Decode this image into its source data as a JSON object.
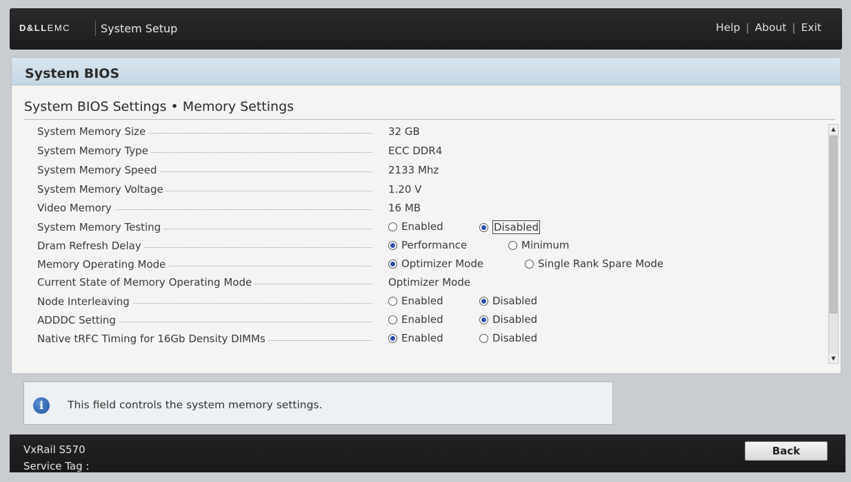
{
  "header": {
    "logo_bold": "D&LL",
    "logo_rest": "EMC",
    "title": "System Setup",
    "links": [
      "Help",
      "About",
      "Exit"
    ]
  },
  "panel": {
    "title": "System BIOS",
    "breadcrumb": "System BIOS Settings • Memory Settings"
  },
  "settings": [
    {
      "label": "System Memory Size",
      "value": "32 GB"
    },
    {
      "label": "System Memory Type",
      "value": "ECC DDR4"
    },
    {
      "label": "System Memory Speed",
      "value": "2133 Mhz"
    },
    {
      "label": "System Memory Voltage",
      "value": "1.20 V"
    },
    {
      "label": "Video Memory",
      "value": "16 MB"
    },
    {
      "label": "System Memory Testing",
      "options": [
        "Enabled",
        "Disabled"
      ],
      "selected": 1,
      "focused": 1
    },
    {
      "label": "Dram Refresh Delay",
      "options": [
        "Performance",
        "Minimum"
      ],
      "selected": 0
    },
    {
      "label": "Memory Operating Mode",
      "options": [
        "Optimizer Mode",
        "Single Rank Spare Mode"
      ],
      "selected": 0
    },
    {
      "label": "Current State of Memory Operating Mode",
      "value": "Optimizer Mode"
    },
    {
      "label": "Node Interleaving",
      "options": [
        "Enabled",
        "Disabled"
      ],
      "selected": 1
    },
    {
      "label": "ADDDC Setting",
      "options": [
        "Enabled",
        "Disabled"
      ],
      "selected": 1
    },
    {
      "label": "Native tRFC Timing for 16Gb Density DIMMs",
      "options": [
        "Enabled",
        "Disabled"
      ],
      "selected": 0
    }
  ],
  "help_text": "This field controls the system memory settings.",
  "footer": {
    "model": "VxRail S570",
    "service_tag_label": "Service Tag :",
    "back_label": "Back"
  },
  "colors": {
    "header_bg": "#1f1f21",
    "panel_header_bg": "#cfdfea",
    "radio_selected": "#2a4fa8"
  }
}
